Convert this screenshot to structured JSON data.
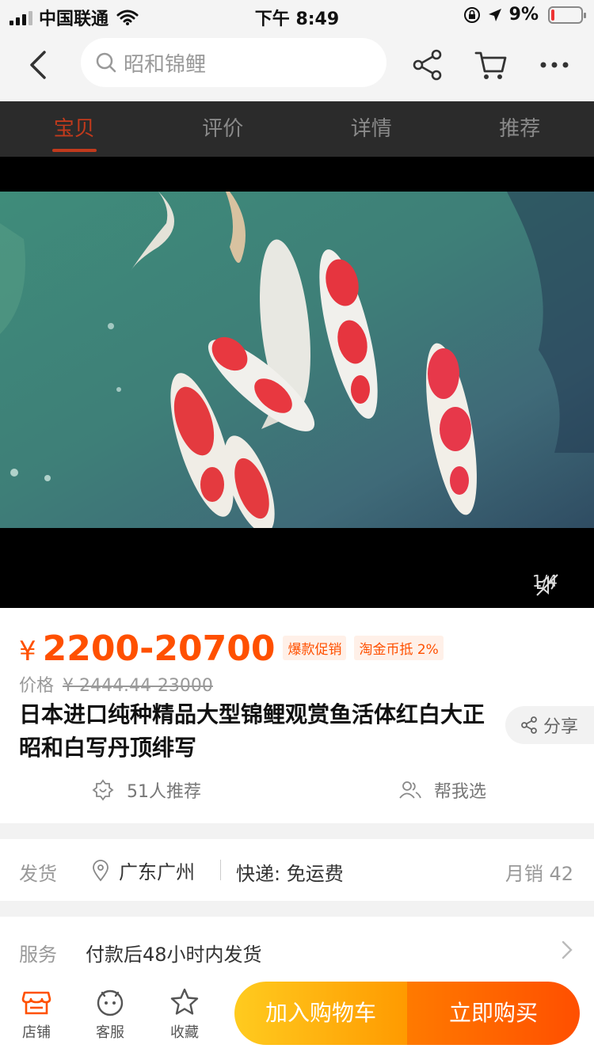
{
  "status_bar": {
    "carrier": "中国联通",
    "time": "下午 8:49",
    "battery": "9%",
    "battery_level": 0.09
  },
  "nav": {
    "search_placeholder": "昭和锦鲤",
    "icons": [
      "back-icon",
      "search-icon",
      "share-icon",
      "cart-icon",
      "more-icon"
    ]
  },
  "tabs": [
    {
      "label": "宝贝",
      "active": true
    },
    {
      "label": "评价",
      "active": false
    },
    {
      "label": "详情",
      "active": false
    },
    {
      "label": "推荐",
      "active": false
    }
  ],
  "media": {
    "page_indicator": "1/4"
  },
  "product": {
    "currency": "¥",
    "price": "2200-20700",
    "tags": [
      "爆款促销",
      "淘金币抵 2%"
    ],
    "old_price_label": "价格",
    "old_price": "¥ 2444.44-23000",
    "title": "日本进口纯种精品大型锦鲤观赏鱼活体红白大正昭和白写丹顶绯写",
    "share_label": "分享",
    "recommend_label": "51人推荐",
    "help_label": "帮我选"
  },
  "shipping": {
    "label": "发货",
    "location": "广东广州",
    "fee": "快递: 免运费",
    "monthly_sales": "月销 42"
  },
  "service": {
    "label": "服务",
    "text": "付款后48小时内发货"
  },
  "bottom_bar": {
    "shop_label": "店铺",
    "service_label": "客服",
    "favorite_label": "收藏",
    "add_cart_label": "加入购物车",
    "buy_now_label": "立即购买"
  },
  "colors": {
    "accent": "#ff5000",
    "tab_active": "#c23a1c",
    "cart_button": "#ffb400",
    "buy_button": "#ff5a00"
  }
}
